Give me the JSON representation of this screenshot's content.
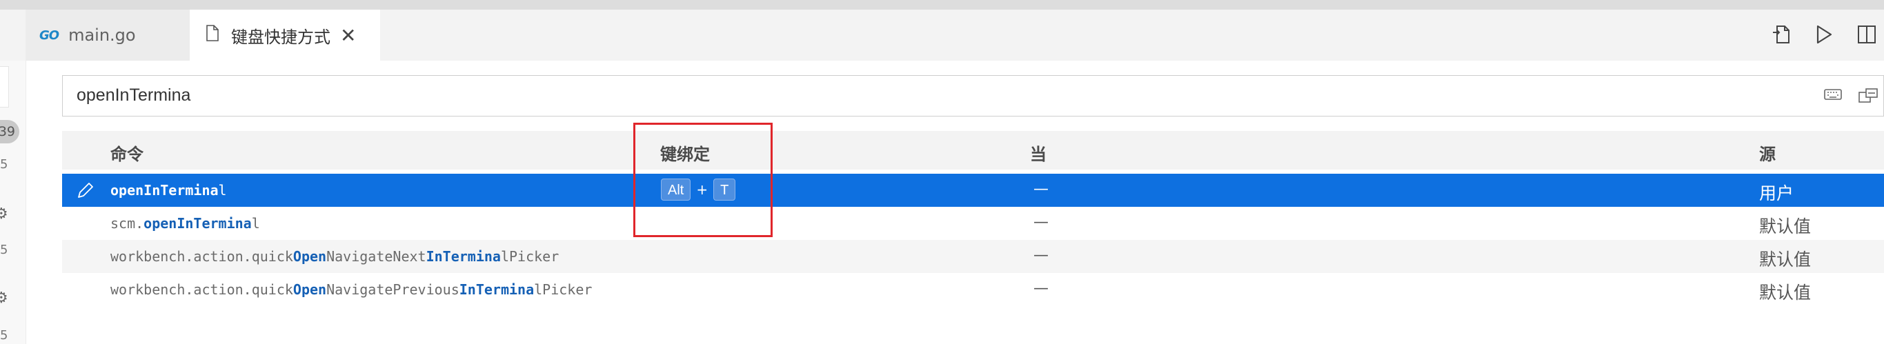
{
  "tabs": [
    {
      "icon": "go-icon",
      "icon_text": "GO",
      "label": "main.go",
      "active": false
    },
    {
      "icon": "file-icon",
      "label": "键盘快捷方式",
      "active": true
    }
  ],
  "gutter": {
    "badge": "39",
    "numbers": [
      "5",
      "5",
      "5"
    ]
  },
  "search": {
    "value": "openInTermina"
  },
  "table": {
    "headers": {
      "command": "命令",
      "keybinding": "键绑定",
      "when": "当",
      "source": "源"
    },
    "rows": [
      {
        "selected": true,
        "command_parts": [
          [
            "openInTermina",
            true
          ],
          [
            "l",
            false
          ]
        ],
        "keys": [
          "Alt",
          "T"
        ],
        "key_separator": "+",
        "when": "—",
        "source": "用户"
      },
      {
        "selected": false,
        "command_parts": [
          [
            "scm.",
            false
          ],
          [
            "openInTermina",
            true
          ],
          [
            "l",
            false
          ]
        ],
        "keys": [],
        "when": "—",
        "source": "默认值"
      },
      {
        "selected": false,
        "command_parts": [
          [
            "workbench.action.quick",
            false
          ],
          [
            "Open",
            true
          ],
          [
            "NavigateNext",
            false
          ],
          [
            "InTermina",
            true
          ],
          [
            "lPicker",
            false
          ]
        ],
        "keys": [],
        "when": "—",
        "source": "默认值"
      },
      {
        "selected": false,
        "command_parts": [
          [
            "workbench.action.quick",
            false
          ],
          [
            "Open",
            true
          ],
          [
            "NavigatePrevious",
            false
          ],
          [
            "InTermina",
            true
          ],
          [
            "lPicker",
            false
          ]
        ],
        "keys": [],
        "when": "—",
        "source": "默认值"
      }
    ]
  },
  "colors": {
    "selection": "#0e70e0",
    "highlight": "#1560b5",
    "annotation": "#e0262b"
  }
}
